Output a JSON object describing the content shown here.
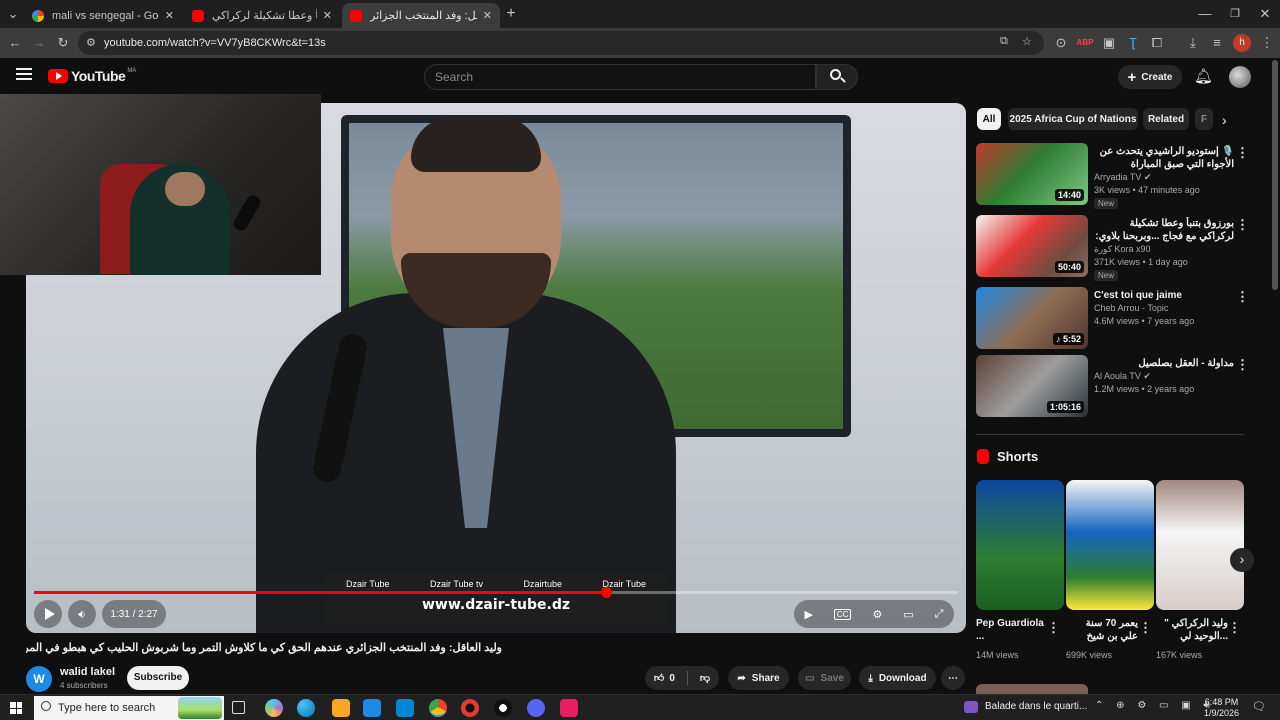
{
  "browser": {
    "tabs": [
      {
        "title": "mali vs sengegal - Google Searc",
        "favicon": "google-icon",
        "active": false
      },
      {
        "title": "بورزوق بتنبأ وعطا تشكيلة لركراكي",
        "favicon": "youtube-icon",
        "active": false
      },
      {
        "title": "وليد العاقل: وفد المنتخب الجزائر",
        "favicon": "youtube-icon",
        "active": true
      }
    ],
    "url": "youtube.com/watch?v=VV7yB8CKWrc&t=13s",
    "profile_letter": "h"
  },
  "youtube": {
    "logo_text": "YouTube",
    "region": "MA",
    "search_placeholder": "Search",
    "create_label": "Create",
    "player": {
      "current_time": "1:31",
      "duration": "2:27",
      "time_label": "1:31 / 2:27",
      "progress": 0.619,
      "ticker_links": [
        "Dzair Tube",
        "Dzair Tube tv",
        "Dzairtube",
        "Dzair Tube"
      ],
      "ticker_url": "www.dzair-tube.dz"
    },
    "video": {
      "title": "وليد العاقل: وفد المنتخب الجزائري عندهم الحق كي ما كلاوش التمر وما شربوش الحليب كي هبطو في المروك.",
      "channel": "walid lakel",
      "channel_initial": "W",
      "subscribers": "4 subscribers",
      "subscribe_label": "Subscribe",
      "likes": "0",
      "share_label": "Share",
      "save_label": "Save",
      "download_label": "Download"
    },
    "chips": [
      "All",
      "2025 Africa Cup of Nations",
      "Related",
      "F"
    ],
    "related": [
      {
        "title": "🎙️ إستوديو الراشيدي يتحدث عن الأجواء التي صبق المباراة",
        "channel": "Arryadia TV",
        "verified": true,
        "meta": "3K views • 47 minutes ago",
        "badge": "New",
        "duration": "14:40"
      },
      {
        "title": "بورزوق بتنبأ وعطا تشكيلة لركراكي مع فجاج ...وبربحنا بلاوي: جلست بزاويني سبرنو",
        "channel": "كورة Kora x90",
        "verified": false,
        "meta": "371K views • 1 day ago",
        "badge": "New",
        "duration": "50:40"
      },
      {
        "title": "C'est toi que jaime",
        "channel": "Cheb Arrou - Topic",
        "verified": false,
        "meta": "4.6M views • 7 years ago",
        "badge": "",
        "duration": "5:52"
      },
      {
        "title": "مداولة - العقل بصلصيل",
        "channel": "Al Aoula TV",
        "verified": true,
        "meta": "1.2M views • 2 years ago",
        "badge": "",
        "duration": "1:05:16"
      }
    ],
    "shorts_heading": "Shorts",
    "shorts": [
      {
        "title": "Pep Guardiola ...",
        "views": "14M views"
      },
      {
        "title": "يعمر 70 سنة علي بن شيخ يملك ...",
        "views": "699K views"
      },
      {
        "title": "وليد الركراكي \" ...الوحيد لي نظمتو",
        "views": "167K views"
      }
    ]
  },
  "taskbar": {
    "search_placeholder": "Type here to search",
    "media_text": "Balade dans le quarti...",
    "time": "6:48 PM",
    "date": "1/9/2026"
  },
  "colors": {
    "accent": "#ff0000",
    "background": "#0f0f0f",
    "chip": "#272727"
  }
}
